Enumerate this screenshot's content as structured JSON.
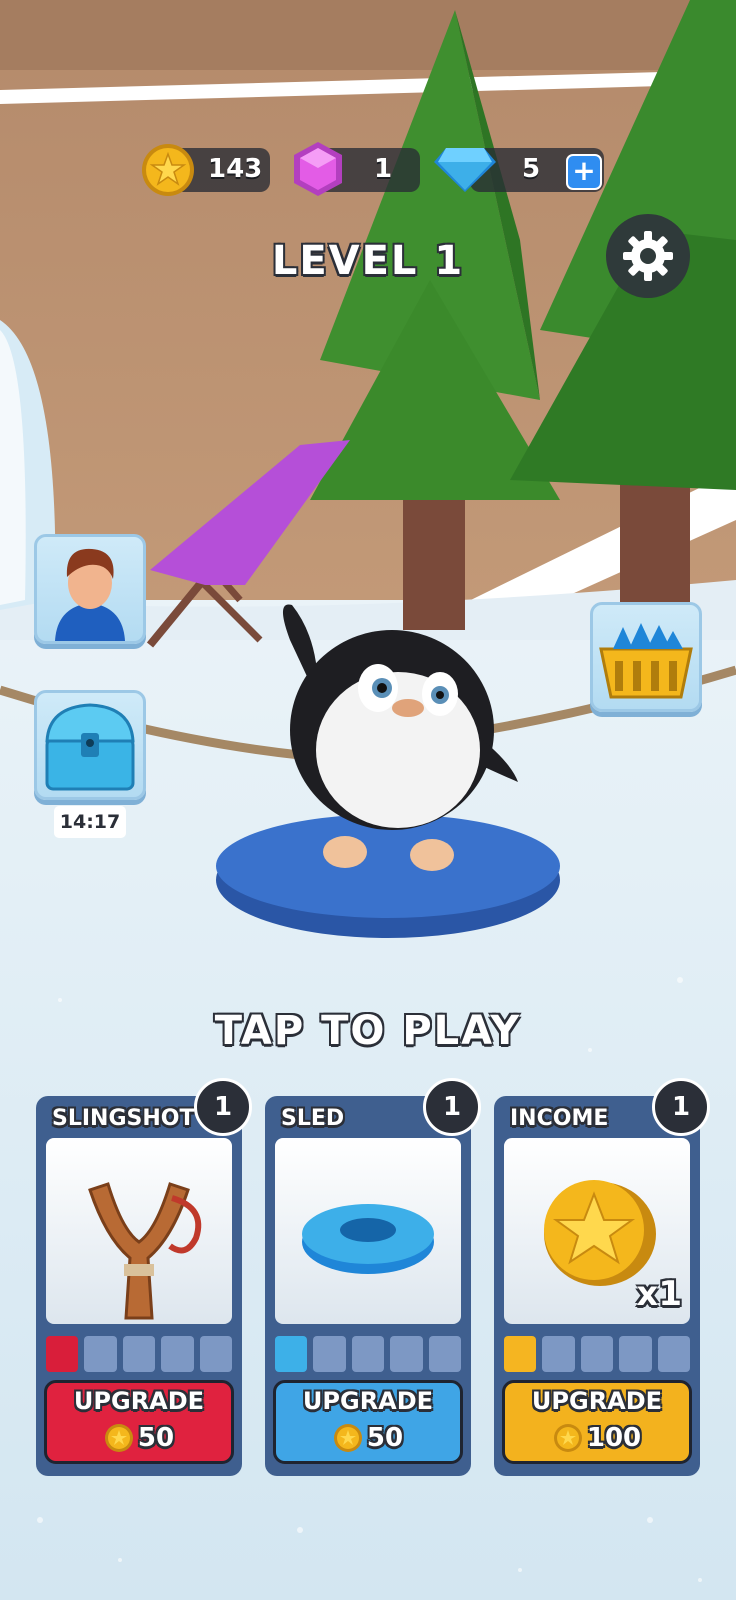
{
  "currencies": {
    "coins": "143",
    "gems": "1",
    "diamonds": "5"
  },
  "level_title": "LEVEL 1",
  "chest_timer": "14:17",
  "tap_to_play": "TAP TO PLAY",
  "upgrades": [
    {
      "title": "SLINGSHOT",
      "level": "1",
      "button_label": "UPGRADE",
      "cost": "50",
      "progress_filled": 1,
      "progress_total": 5,
      "color": "#e0223f",
      "seg_color": "#d91e3a"
    },
    {
      "title": "SLED",
      "level": "1",
      "button_label": "UPGRADE",
      "cost": "50",
      "progress_filled": 1,
      "progress_total": 5,
      "color": "#3fa5e6",
      "seg_color": "#3db0e8"
    },
    {
      "title": "INCOME",
      "level": "1",
      "button_label": "UPGRADE",
      "cost": "100",
      "multiplier": "x1",
      "progress_filled": 1,
      "progress_total": 5,
      "color": "#f3b21e",
      "seg_color": "#f5b521"
    }
  ],
  "colors": {
    "coin": "#f4b71c",
    "gem": "#e35ce6",
    "diamond": "#3dafe9",
    "plus_button": "#2f8df1"
  }
}
